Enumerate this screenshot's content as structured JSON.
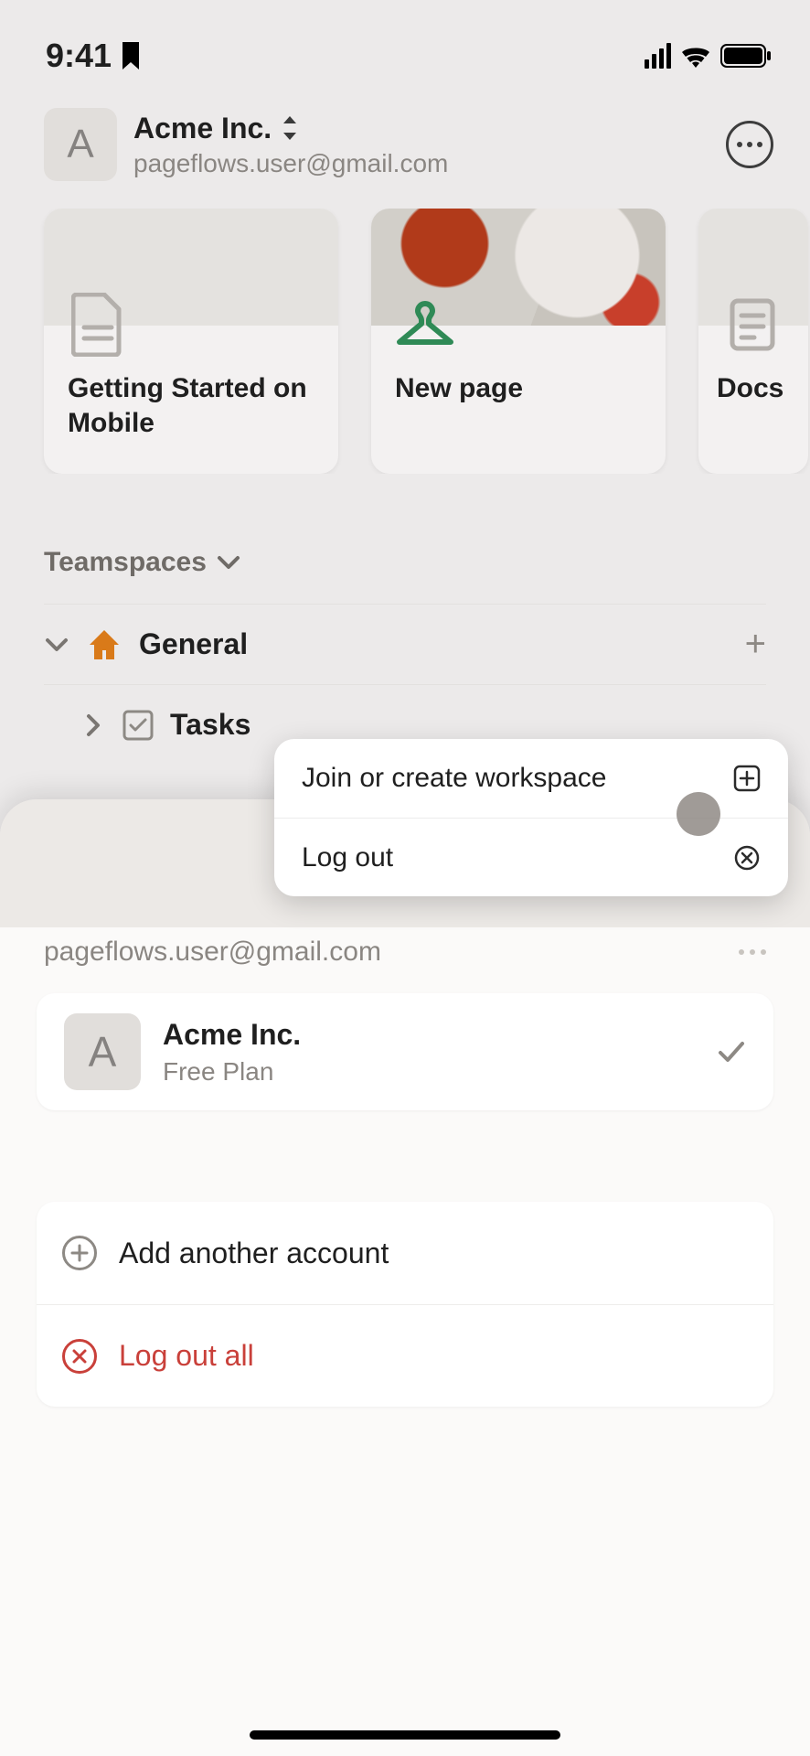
{
  "status_bar": {
    "time": "9:41"
  },
  "header": {
    "workspace_name": "Acme Inc.",
    "email": "pageflows.user@gmail.com",
    "avatar_letter": "A"
  },
  "cards": [
    {
      "title": "Getting Started on Mobile"
    },
    {
      "title": "New page"
    },
    {
      "title": "Docs"
    }
  ],
  "teamspaces": {
    "section_label": "Teamspaces",
    "items": [
      {
        "label": "General",
        "icon": "home"
      },
      {
        "label": "Tasks",
        "icon": "checkbox"
      }
    ]
  },
  "popup": {
    "join_label": "Join or create workspace",
    "logout_label": "Log out"
  },
  "sheet": {
    "email": "pageflows.user@gmail.com",
    "workspace": {
      "name": "Acme Inc.",
      "plan": "Free Plan",
      "avatar_letter": "A"
    },
    "add_account_label": "Add another account",
    "logout_all_label": "Log out all"
  }
}
